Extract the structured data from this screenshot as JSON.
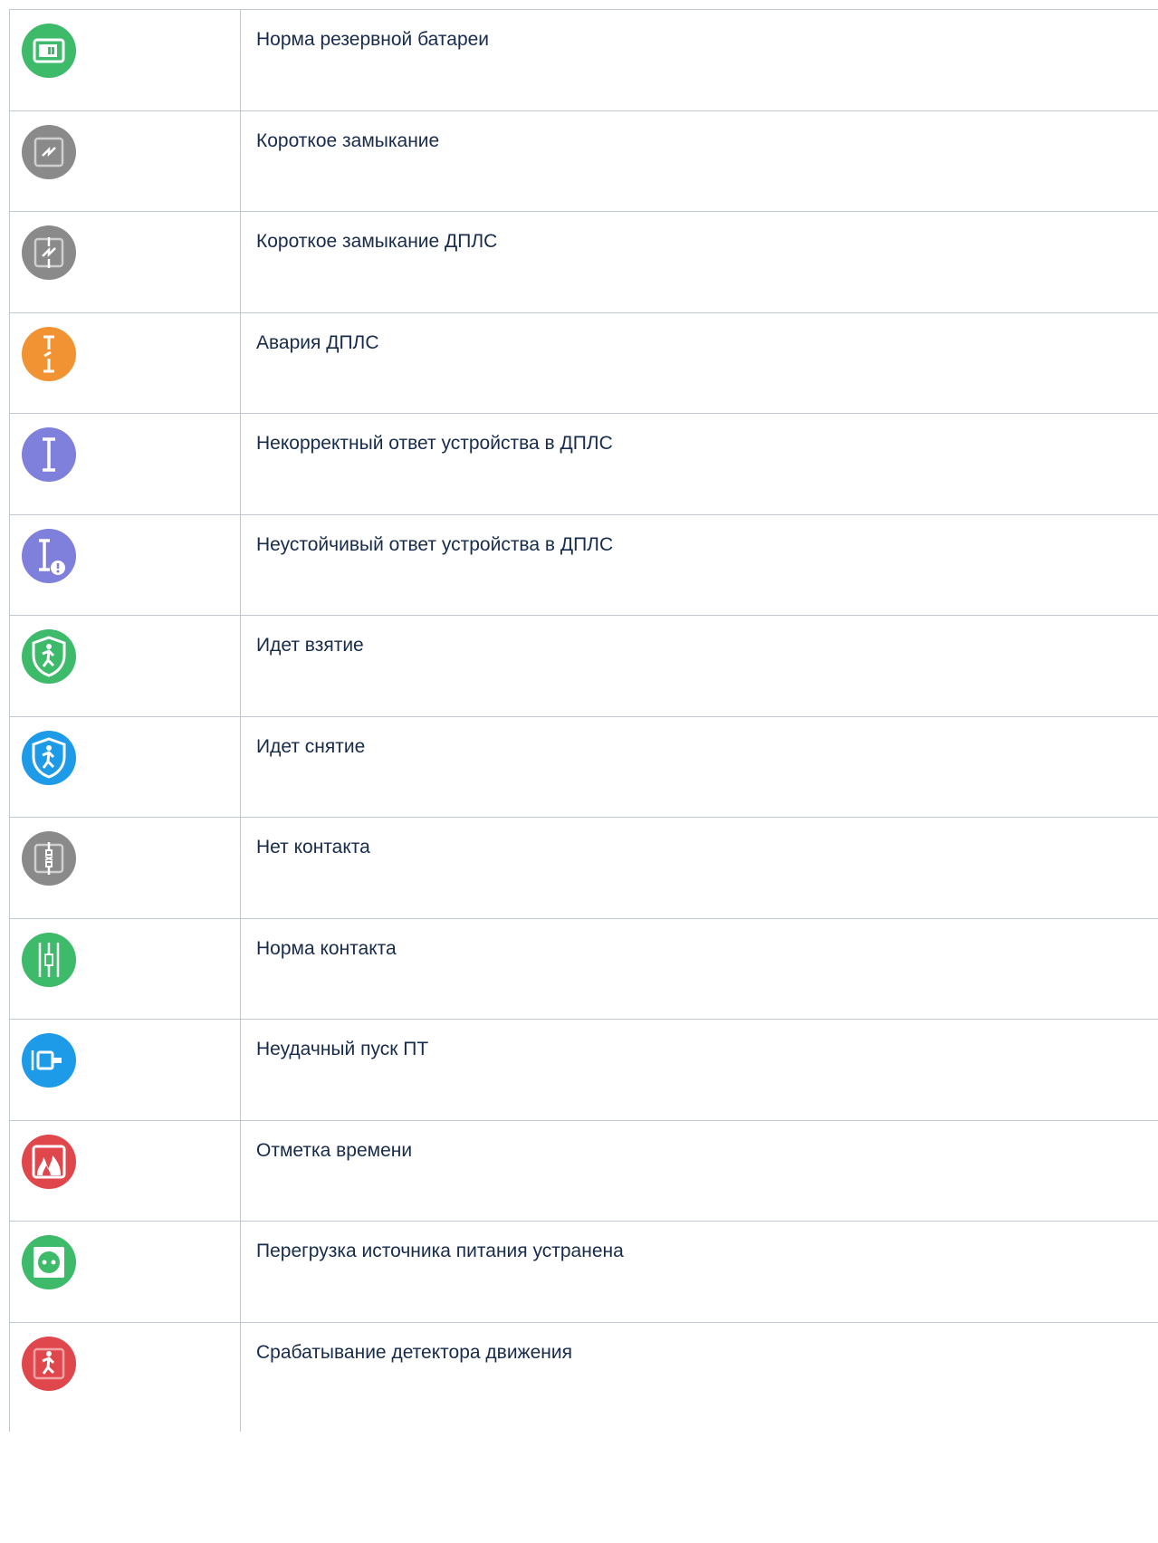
{
  "rows": [
    {
      "label": "Норма резервной батареи",
      "icon": "battery-backup-normal-icon",
      "color": "#3dba6a"
    },
    {
      "label": "Короткое замыкание",
      "icon": "short-circuit-icon",
      "color": "#8a8a8a"
    },
    {
      "label": "Короткое замыкание ДПЛС",
      "icon": "dpls-short-circuit-icon",
      "color": "#8a8a8a"
    },
    {
      "label": "Авария ДПЛС",
      "icon": "dpls-failure-icon",
      "color": "#f29333"
    },
    {
      "label": "Некорректный ответ устройства в ДПЛС",
      "icon": "dpls-device-incorrect-response-icon",
      "color": "#7f7fdc"
    },
    {
      "label": "Неустойчивый ответ устройства в ДПЛС",
      "icon": "dpls-device-unstable-response-icon",
      "color": "#7f7fdc"
    },
    {
      "label": "Идет взятие",
      "icon": "arming-in-progress-icon",
      "color": "#3dba6a"
    },
    {
      "label": "Идет снятие",
      "icon": "disarming-in-progress-icon",
      "color": "#1e9be8"
    },
    {
      "label": "Нет контакта",
      "icon": "no-contact-icon",
      "color": "#8a8a8a"
    },
    {
      "label": "Норма контакта",
      "icon": "contact-normal-icon",
      "color": "#3dba6a"
    },
    {
      "label": "Неудачный пуск ПТ",
      "icon": "fire-extinguishing-start-failed-icon",
      "color": "#1e9be8"
    },
    {
      "label": "Отметка времени",
      "icon": "time-mark-icon",
      "color": "#e0474c"
    },
    {
      "label": "Перегрузка источника питания устранена",
      "icon": "power-overload-cleared-icon",
      "color": "#3dba6a"
    },
    {
      "label": "Срабатывание детектора движения",
      "icon": "motion-detector-triggered-icon",
      "color": "#e0474c"
    }
  ]
}
